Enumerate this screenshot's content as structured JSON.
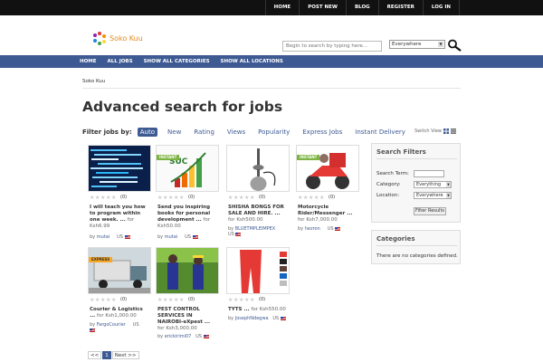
{
  "top_nav": [
    "HOME",
    "POST NEW",
    "BLOG",
    "REGISTER",
    "LOG IN"
  ],
  "logo": {
    "text": "Soko Kuu"
  },
  "search": {
    "placeholder": "Begin to search by typing here...",
    "scope": "Everywhere"
  },
  "main_nav": [
    "HOME",
    "ALL JOBS",
    "SHOW ALL CATEGORIES",
    "SHOW ALL LOCATIONS"
  ],
  "breadcrumb": "Soko Kuu",
  "page_title": "Advanced search for jobs",
  "filters": {
    "label": "Filter jobs by:",
    "options": [
      "Auto",
      "New",
      "Rating",
      "Views",
      "Popularity",
      "Express Jobs",
      "Instant Delivery"
    ],
    "active": "Auto"
  },
  "switch_view": "Switch View",
  "jobs": [
    {
      "title": "I will teach you how to program within one week. ...",
      "for": "for",
      "price": "Ksh6.99",
      "user": "mutai",
      "country": "US",
      "rating_count": "(0)",
      "ribbon": ""
    },
    {
      "title": "Send you inspiring books for personal development ...",
      "for": "for",
      "price": "Ksh50.00",
      "user": "mutai",
      "country": "US",
      "rating_count": "(0)",
      "ribbon": "INSTANT"
    },
    {
      "title": "SHISHA BONGS FOR SALE AND HIRE. ...",
      "for": "for",
      "price": "Ksh500.00",
      "user": "BLUETMPLEIMPEX",
      "country": "US",
      "rating_count": "(0)",
      "ribbon": ""
    },
    {
      "title": "Motorcycle Rider/Messenger ...",
      "for": "for",
      "price": "Ksh7,000.00",
      "user": "hezron",
      "country": "US",
      "rating_count": "(0)",
      "ribbon": "INSTANT"
    },
    {
      "title": "Courier & Logistics ...",
      "for": "for",
      "price": "Ksh1,000.00",
      "user": "FargoCourier",
      "country": "US",
      "rating_count": "(0)",
      "ribbon": "EXPRESS"
    },
    {
      "title": "PEST CONTROL SERVICES IN NAIROBI-eXpest ...",
      "for": "for",
      "price": "Ksh3,000.00",
      "user": "erickirimi07",
      "country": "US",
      "rating_count": "(0)",
      "ribbon": ""
    },
    {
      "title": "TYTS ...",
      "for": "for",
      "price": "Ksh550.00",
      "user": "JosephNdegwa",
      "country": "US",
      "rating_count": "(0)",
      "ribbon": ""
    }
  ],
  "search_filters": {
    "title": "Search Filters",
    "term_label": "Search Term:",
    "category_label": "Category:",
    "category_value": "Everything",
    "location_label": "Location:",
    "location_value": "Everywhere",
    "button": "Filter Results"
  },
  "categories": {
    "title": "Categories",
    "empty": "There are no categories defined."
  },
  "pagination": [
    "<<",
    "1",
    "Next >>"
  ],
  "colors": {
    "topbar": "#111111",
    "nav": "#3d5a93",
    "accent": "#3d5a93",
    "logo": "#e58a1f"
  }
}
